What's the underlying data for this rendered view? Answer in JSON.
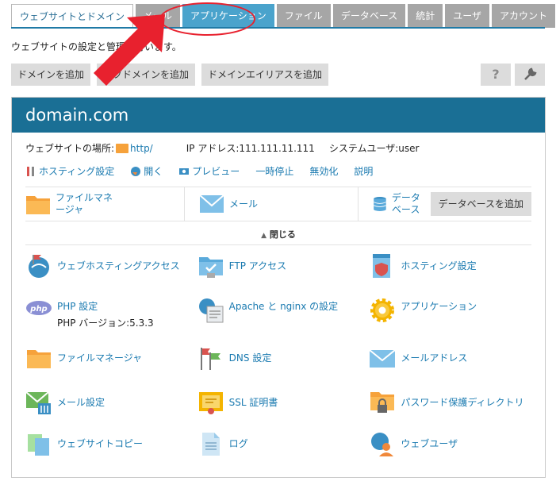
{
  "tabs": [
    {
      "label": "ウェブサイトとドメイン",
      "active": true
    },
    {
      "label": "メール"
    },
    {
      "label": "アプリケーション",
      "highlight": true
    },
    {
      "label": "ファイル"
    },
    {
      "label": "データベース"
    },
    {
      "label": "統計"
    },
    {
      "label": "ユーザ"
    },
    {
      "label": "アカウント"
    }
  ],
  "description": "ウェブサイトの設定と管理を行います。",
  "actions": {
    "add_domain": "ドメインを追加",
    "add_subdomain": "サブドメインを追加",
    "add_alias": "ドメインエイリアスを追加",
    "help": "?"
  },
  "domain": {
    "name": "domain.com",
    "location_label": "ウェブサイトの場所:",
    "location_value": "http/",
    "ip_label": "IP アドレス:",
    "ip_value": "111.111.11.111",
    "sysuser_label": "システムユーザ:",
    "sysuser_value": "user"
  },
  "quick_links": {
    "hosting": "ホスティング設定",
    "open": "開く",
    "preview": "プレビュー",
    "suspend": "一時停止",
    "disable": "無効化",
    "description": "説明"
  },
  "cards": {
    "file_manager": "ファイルマネージャ",
    "mail": "メール",
    "database": "データベース",
    "add_database": "データベースを追加"
  },
  "collapse_label": "閉じる",
  "features": [
    [
      {
        "label": "ウェブホスティングアクセス",
        "icon": "globe-flag-icon"
      },
      {
        "label": "FTP アクセス",
        "icon": "ftp-folder-icon"
      },
      {
        "label": "ホスティング設定",
        "icon": "hosting-settings-icon"
      }
    ],
    [
      {
        "label": "PHP 設定",
        "sub": "PHP バージョン:5.3.3",
        "icon": "php-icon"
      },
      {
        "label": "Apache と nginx の設定",
        "icon": "web-server-icon"
      },
      {
        "label": "アプリケーション",
        "icon": "gear-icon"
      }
    ],
    [
      {
        "label": "ファイルマネージャ",
        "icon": "folder-icon"
      },
      {
        "label": "DNS 設定",
        "icon": "dns-flags-icon"
      },
      {
        "label": "メールアドレス",
        "icon": "envelope-icon"
      }
    ],
    [
      {
        "label": "メール設定",
        "icon": "mail-settings-icon"
      },
      {
        "label": "SSL 証明書",
        "icon": "certificate-icon"
      },
      {
        "label": "パスワード保護ディレクトリ",
        "icon": "lock-folder-icon"
      }
    ],
    [
      {
        "label": "ウェブサイトコピー",
        "icon": "copy-icon"
      },
      {
        "label": "ログ",
        "icon": "log-icon"
      },
      {
        "label": "ウェブユーザ",
        "icon": "web-user-icon"
      }
    ]
  ],
  "colors": {
    "header": "#1a6f95",
    "link": "#1a7ab0",
    "annotation": "#e8212e"
  }
}
